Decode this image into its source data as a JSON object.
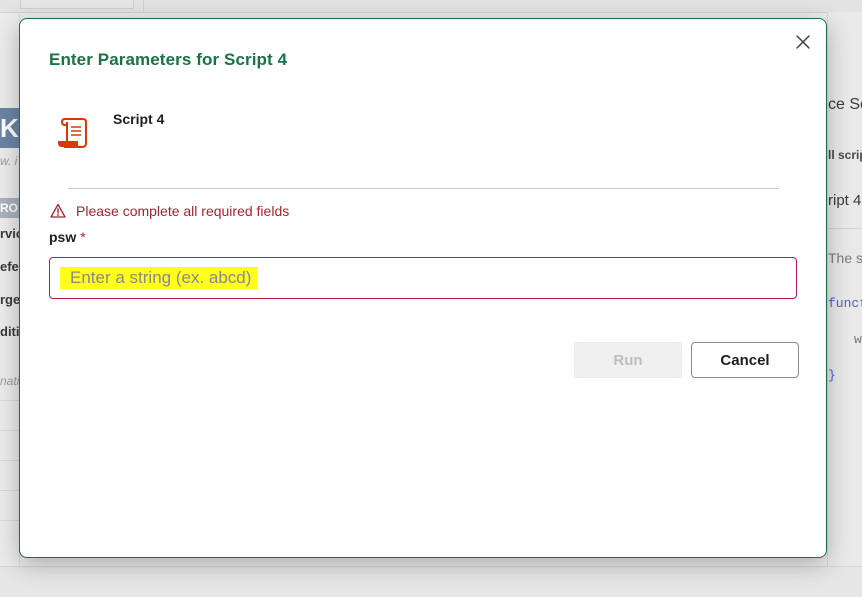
{
  "dialog": {
    "title": "Enter Parameters for Script 4",
    "script_name": "Script 4",
    "error_message": "Please complete all required fields",
    "field": {
      "label": "psw",
      "required_mark": "*",
      "placeholder": "Enter a string (ex. abcd)",
      "value": ""
    },
    "buttons": {
      "run": "Run",
      "cancel": "Cancel"
    },
    "icons": {
      "close": "close-icon",
      "script": "script-scroll-icon",
      "warning": "warning-icon"
    }
  },
  "background": {
    "left_fragments": [
      "K",
      "w. i",
      "RO",
      "rvic",
      "efe",
      "rge",
      "diti",
      "nati"
    ],
    "right_fragments": [
      "ce Sc",
      "ll scrip",
      "ript 4",
      "The s",
      "functi",
      "w",
      "}"
    ]
  },
  "colors": {
    "title_green": "#1a7346",
    "error_red": "#a4262c",
    "input_border": "#b3195a",
    "highlight_yellow": "#ffff1a",
    "icon_orange": "#d83b01"
  }
}
